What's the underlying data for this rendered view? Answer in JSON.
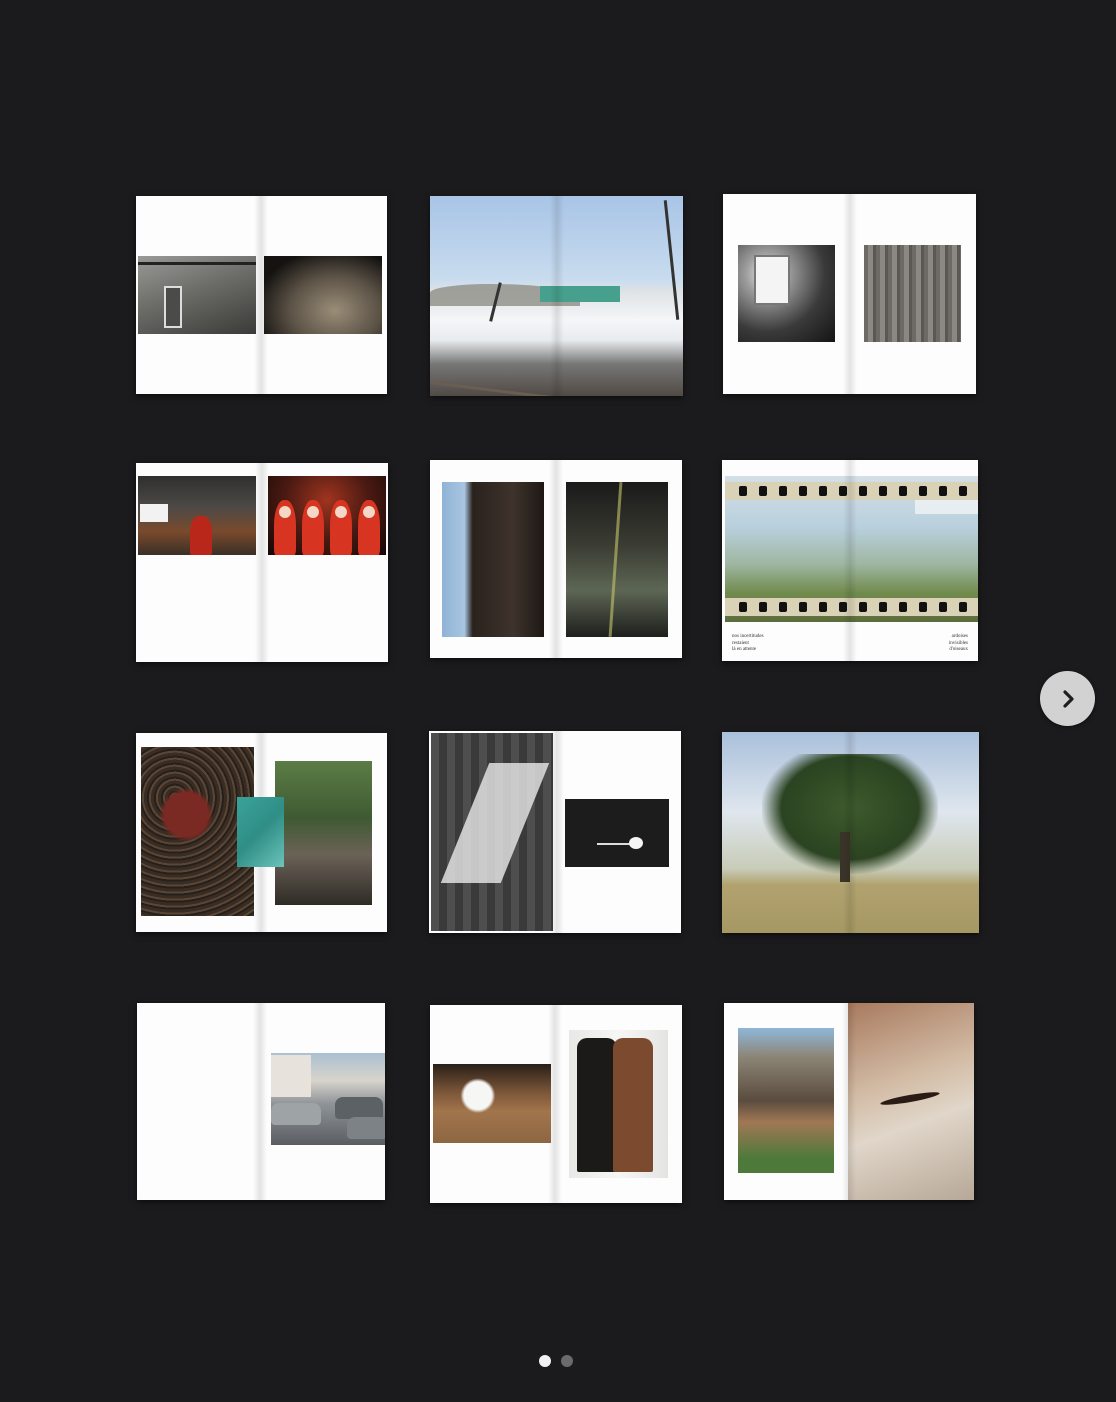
{
  "gallery": {
    "spreads": [
      {
        "name": "spread-1"
      },
      {
        "name": "spread-2"
      },
      {
        "name": "spread-3"
      },
      {
        "name": "spread-4"
      },
      {
        "name": "spread-5"
      },
      {
        "name": "spread-6",
        "caption_left": "nos incertitudes\nrestaient\nlà en attente",
        "caption_right": "ardoises\ninvisibles\nd'oiseaux"
      },
      {
        "name": "spread-7"
      },
      {
        "name": "spread-8"
      },
      {
        "name": "spread-9"
      },
      {
        "name": "spread-10"
      },
      {
        "name": "spread-11"
      },
      {
        "name": "spread-12"
      }
    ],
    "total_slides": 2,
    "current_slide": 1
  },
  "navigation": {
    "next_icon": "chevron-right-icon"
  },
  "colors": {
    "background": "#1b1b1d",
    "page": "#fdfdfd",
    "dot_active": "#f2f2f2",
    "dot_inactive": "#6b6b6b",
    "button": "#d2d2d2"
  }
}
